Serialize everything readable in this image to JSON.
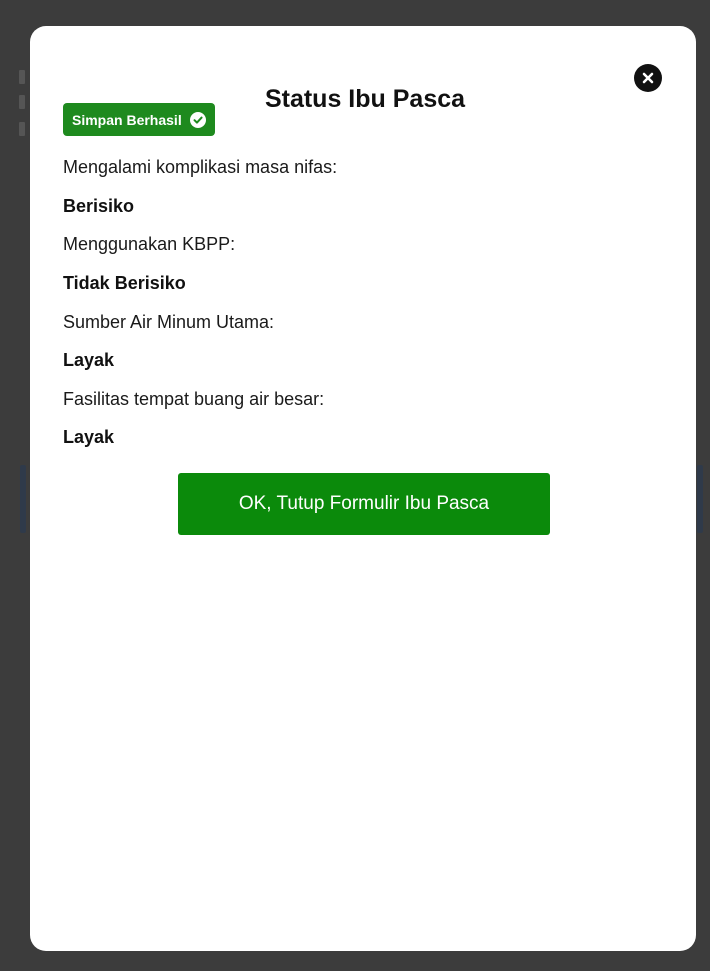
{
  "modal": {
    "title": "Status Ibu Pasca",
    "badge": {
      "label": "Simpan Berhasil",
      "icon": "check-circle-icon",
      "color": "#1e8a1e"
    },
    "fields": [
      {
        "label": "Mengalami komplikasi masa nifas:",
        "value": "Berisiko"
      },
      {
        "label": "Menggunakan KBPP:",
        "value": "Tidak Berisiko"
      },
      {
        "label": "Sumber Air Minum Utama:",
        "value": "Layak"
      },
      {
        "label": "Fasilitas tempat buang air besar:",
        "value": "Layak"
      }
    ],
    "ok_button_label": "OK, Tutup Formulir Ibu Pasca",
    "ok_button_color": "#0b8a0b",
    "close_icon": "close-circle-icon"
  }
}
